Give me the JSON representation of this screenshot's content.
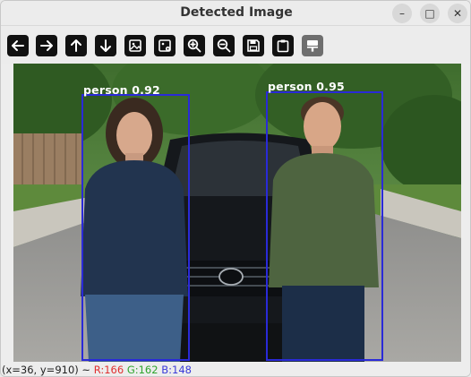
{
  "window": {
    "title": "Detected Image",
    "controls": [
      "–",
      "□",
      "✕"
    ]
  },
  "toolbar": {
    "buttons": [
      {
        "icon": "arrow-left-icon"
      },
      {
        "icon": "arrow-right-icon"
      },
      {
        "icon": "arrow-up-icon"
      },
      {
        "icon": "arrow-down-icon"
      },
      {
        "icon": "image-icon"
      },
      {
        "icon": "image-settings-icon"
      },
      {
        "icon": "zoom-in-icon"
      },
      {
        "icon": "zoom-out-icon"
      },
      {
        "icon": "save-icon"
      },
      {
        "icon": "clipboard-icon"
      },
      {
        "icon": "paint-icon",
        "disabled": true
      }
    ]
  },
  "detections": [
    {
      "label": "person 0.92",
      "color": "#2a2ad8"
    },
    {
      "label": "person 0.95",
      "color": "#2a2ad8"
    }
  ],
  "status": {
    "coords": "(x=36, y=910) ~",
    "r": "R:166",
    "g": "G:162",
    "b": "B:148"
  }
}
